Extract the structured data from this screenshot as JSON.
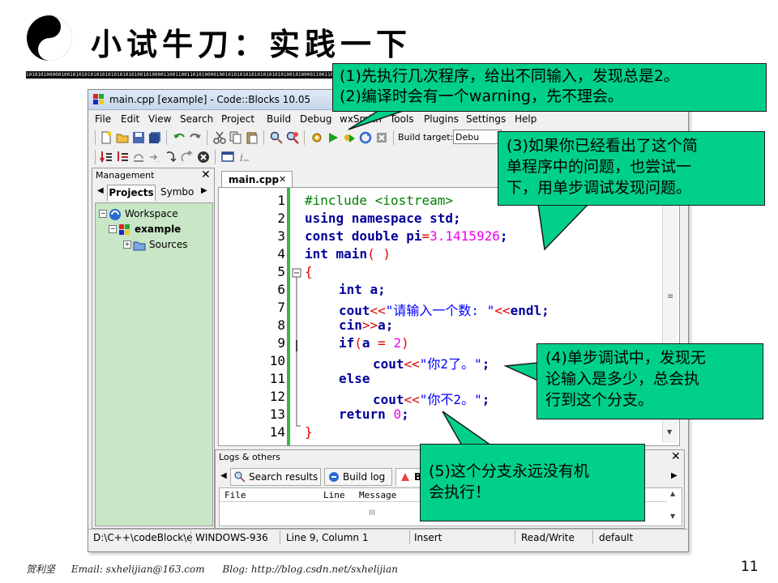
{
  "slide": {
    "title": "小试牛刀：实践一下",
    "binary_strip": "1010101000001001010101010101010101010100101000011001100110101000010010101010101010101010100101000011001100110101000010010101010",
    "page_number": "11",
    "footer": {
      "author": "贺利坚",
      "email": "Email:  sxhelijian@163.com",
      "blog": "Blog:  http://blog.csdn.net/sxhelijian"
    }
  },
  "window": {
    "title": "main.cpp [example] - Code::Blocks 10.05",
    "menu": [
      "File",
      "Edit",
      "View",
      "Search",
      "Project",
      "Build",
      "Debug",
      "wxSmith",
      "Tools",
      "Plugins",
      "Settings",
      "Help"
    ],
    "build_target_label": "Build target:",
    "build_target_value": "Debu"
  },
  "management": {
    "header": "Management",
    "tabs": [
      "Projects",
      "Symbo"
    ],
    "tree": {
      "workspace": "Workspace",
      "project": "example",
      "folder": "Sources"
    }
  },
  "editor": {
    "tab_label": "main.cpp",
    "line_numbers": [
      "1",
      "2",
      "3",
      "4",
      "5",
      "6",
      "7",
      "8",
      "9",
      "10",
      "11",
      "12",
      "13",
      "14"
    ],
    "lines": {
      "l1": "#include <iostream>",
      "l2a": "using namespace",
      "l2b": " std;",
      "l3a": "const double",
      "l3b": " pi",
      "l3c": "=",
      "l3d": "3.1415926",
      "l3e": ";",
      "l4a": "int",
      "l4b": " main",
      "l4c": "( )",
      "l5": "{",
      "l6a": "int",
      "l6b": " a;",
      "l7a": "cout",
      "l7b": "<<",
      "l7c": "\"请输入一个数: \"",
      "l7d": "<<",
      "l7e": "endl;",
      "l8a": "cin",
      "l8b": ">>",
      "l8c": "a;",
      "l9a": "if",
      "l9b": "(",
      "l9c": "a ",
      "l9d": "=",
      "l9e": " ",
      "l9f": "2",
      "l9g": ")",
      "l10a": "cout",
      "l10b": "<<",
      "l10c": "\"你2了。\"",
      "l10d": ";",
      "l11": "else",
      "l12a": "cout",
      "l12b": "<<",
      "l12c": "\"你不2。\"",
      "l12d": ";",
      "l13a": "return",
      "l13b": " ",
      "l13c": "0",
      "l13d": ";",
      "l14": "}"
    }
  },
  "logs": {
    "header": "Logs & others",
    "tabs": [
      "Search results",
      "Build log",
      "B"
    ],
    "columns": [
      "File",
      "Line",
      "Message"
    ]
  },
  "statusbar": {
    "path": "D:\\C++\\codeBlock\\e",
    "encoding": "WINDOWS-936",
    "position": "Line 9, Column 1",
    "mode": "Insert",
    "access": "Read/Write",
    "profile": "default"
  },
  "callouts": {
    "c1": [
      "(1)先执行几次程序，给出不同输入，发现总是2。",
      "(2)编译时会有一个warning，先不理会。"
    ],
    "c3": [
      "(3)如果你已经看出了这个简",
      "单程序中的问题，也尝试一",
      "下，用单步调试发现问题。"
    ],
    "c4": [
      "(4)单步调试中，发现无",
      "论输入是多少，总会执",
      "行到这个分支。"
    ],
    "c5": [
      "(5)这个分支永远没有机",
      "会执行！"
    ]
  },
  "colors": {
    "callout_bg": "#00d08a",
    "keyword": "#00009a",
    "preprocessor": "#008000",
    "string": "#0000ff",
    "number": "#ee00ee",
    "operator": "#e00000",
    "tree_bg": "#c9e6c7",
    "change_bar": "#2fbd40"
  }
}
